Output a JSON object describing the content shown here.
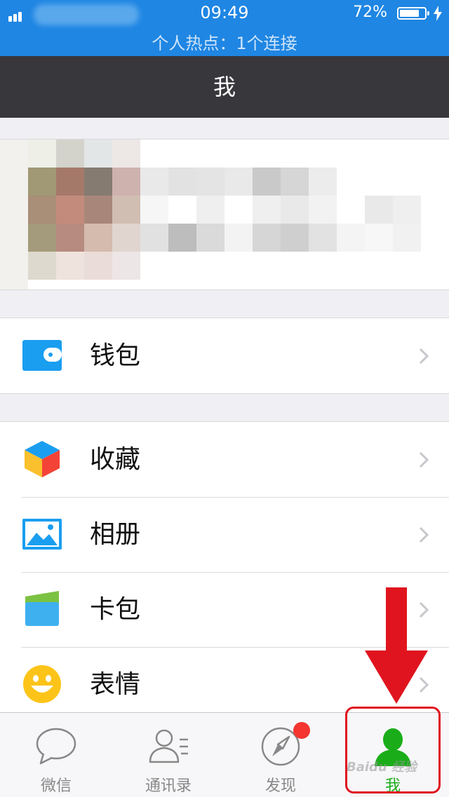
{
  "status_bar": {
    "time": "09:49",
    "battery": "72%",
    "battery_level": 0.72,
    "hotspot": "个人热点：1个连接"
  },
  "nav": {
    "title": "我"
  },
  "menu": {
    "wallet": "钱包",
    "favorites": "收藏",
    "album": "相册",
    "cards": "卡包",
    "stickers": "表情"
  },
  "tabs": [
    {
      "label": "微信",
      "icon": "chat-bubble-icon"
    },
    {
      "label": "通讯录",
      "icon": "contacts-icon"
    },
    {
      "label": "发现",
      "icon": "compass-icon",
      "badge": true
    },
    {
      "label": "我",
      "icon": "person-icon",
      "active": true
    }
  ],
  "colors": {
    "status_bar": "#1f86e3",
    "nav_bar": "#38373c",
    "active_tab": "#1aad19",
    "annotation_red": "#e0141e"
  }
}
